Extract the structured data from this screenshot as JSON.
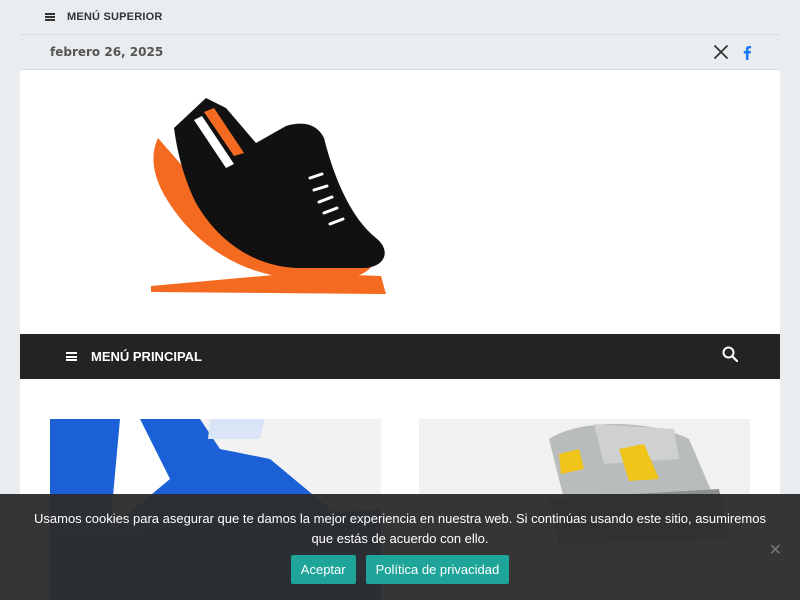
{
  "top_menu": {
    "label": "MENÚ SUPERIOR"
  },
  "date_bar": {
    "date": "febrero 26, 2025"
  },
  "social": {
    "x_icon": "x-twitter-icon",
    "facebook_icon": "facebook-icon",
    "facebook_color": "#1877f2"
  },
  "main_nav": {
    "label": "MENÚ PRINCIPAL",
    "search_icon": "search-icon"
  },
  "cookie_notice": {
    "text": "Usamos cookies para asegurar que te damos la mejor experiencia en nuestra web. Si continúas usando este sitio, asumiremos que estás de acuerdo con ello.",
    "accept_label": "Aceptar",
    "privacy_label": "Política de privacidad",
    "close_label": "✕",
    "button_color": "#1fa49a"
  },
  "colors": {
    "logo_orange": "#f46a20",
    "logo_black": "#111111",
    "nav_background": "#232323"
  }
}
